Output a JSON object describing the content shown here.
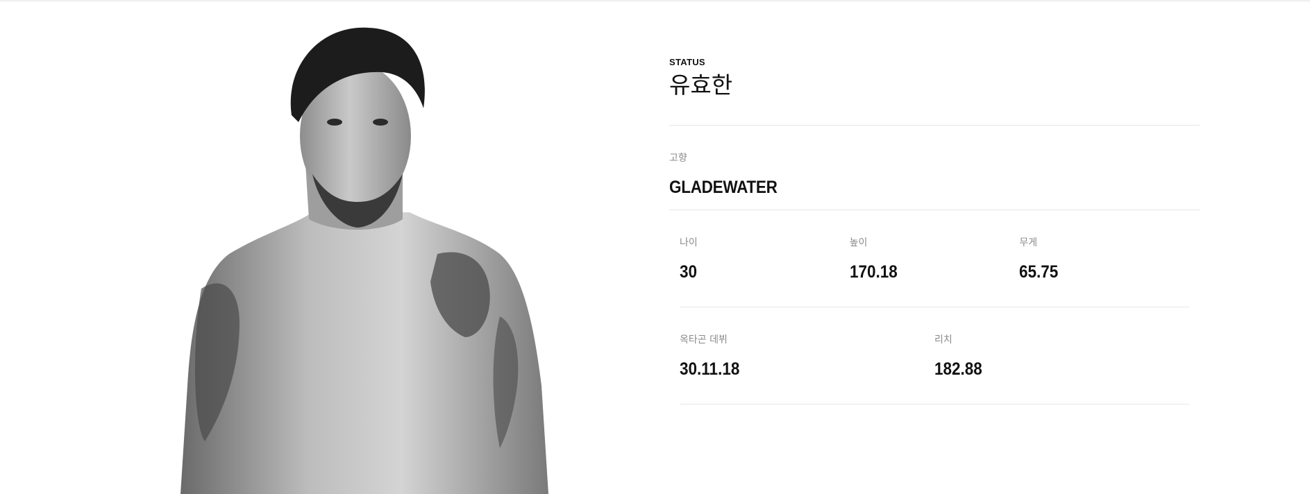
{
  "fighter": {
    "status_label": "STATUS",
    "name": "유효한",
    "hometown_label": "고향",
    "hometown": "GLADEWATER"
  },
  "stats": {
    "row1": [
      {
        "label": "나이",
        "value": "30"
      },
      {
        "label": "높이",
        "value": "170.18"
      },
      {
        "label": "무게",
        "value": "65.75"
      }
    ],
    "row2": [
      {
        "label": "옥타곤 데뷔",
        "value": "30.11.18"
      },
      {
        "label": "리치",
        "value": "182.88"
      }
    ]
  }
}
